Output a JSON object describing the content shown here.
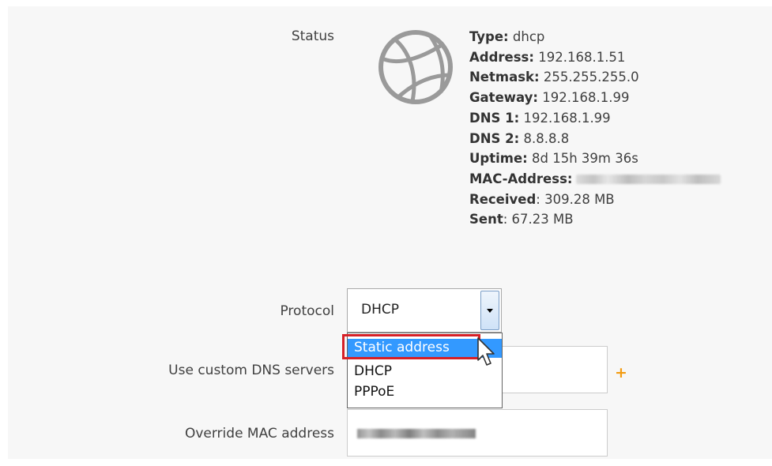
{
  "status": {
    "label": "Status",
    "icon": "globe-icon",
    "fields": [
      {
        "key": "Type:",
        "value": " dhcp"
      },
      {
        "key": "Address:",
        "value": " 192.168.1.51"
      },
      {
        "key": "Netmask:",
        "value": " 255.255.255.0"
      },
      {
        "key": "Gateway:",
        "value": " 192.168.1.99"
      },
      {
        "key": "DNS 1:",
        "value": " 192.168.1.99"
      },
      {
        "key": "DNS 2:",
        "value": " 8.8.8.8"
      },
      {
        "key": "Uptime:",
        "value": " 8d 15h 39m 36s"
      },
      {
        "key": "MAC-Address:",
        "value": ""
      },
      {
        "key": "Received",
        "value": ": 309.28 MB"
      },
      {
        "key": "Sent",
        "value": ": 67.23 MB"
      }
    ]
  },
  "protocol": {
    "label": "Protocol",
    "selected": "DHCP",
    "options": [
      "Static address",
      "DHCP",
      "PPPoE"
    ],
    "highlighted_option": "Static address"
  },
  "dns": {
    "label": "Use custom DNS servers",
    "add_glyph": "+"
  },
  "mac_override": {
    "label": "Override MAC address"
  },
  "colors": {
    "accent_selected": "#3399ff",
    "highlight_border": "#d62027",
    "add_icon": "#f39c12"
  }
}
